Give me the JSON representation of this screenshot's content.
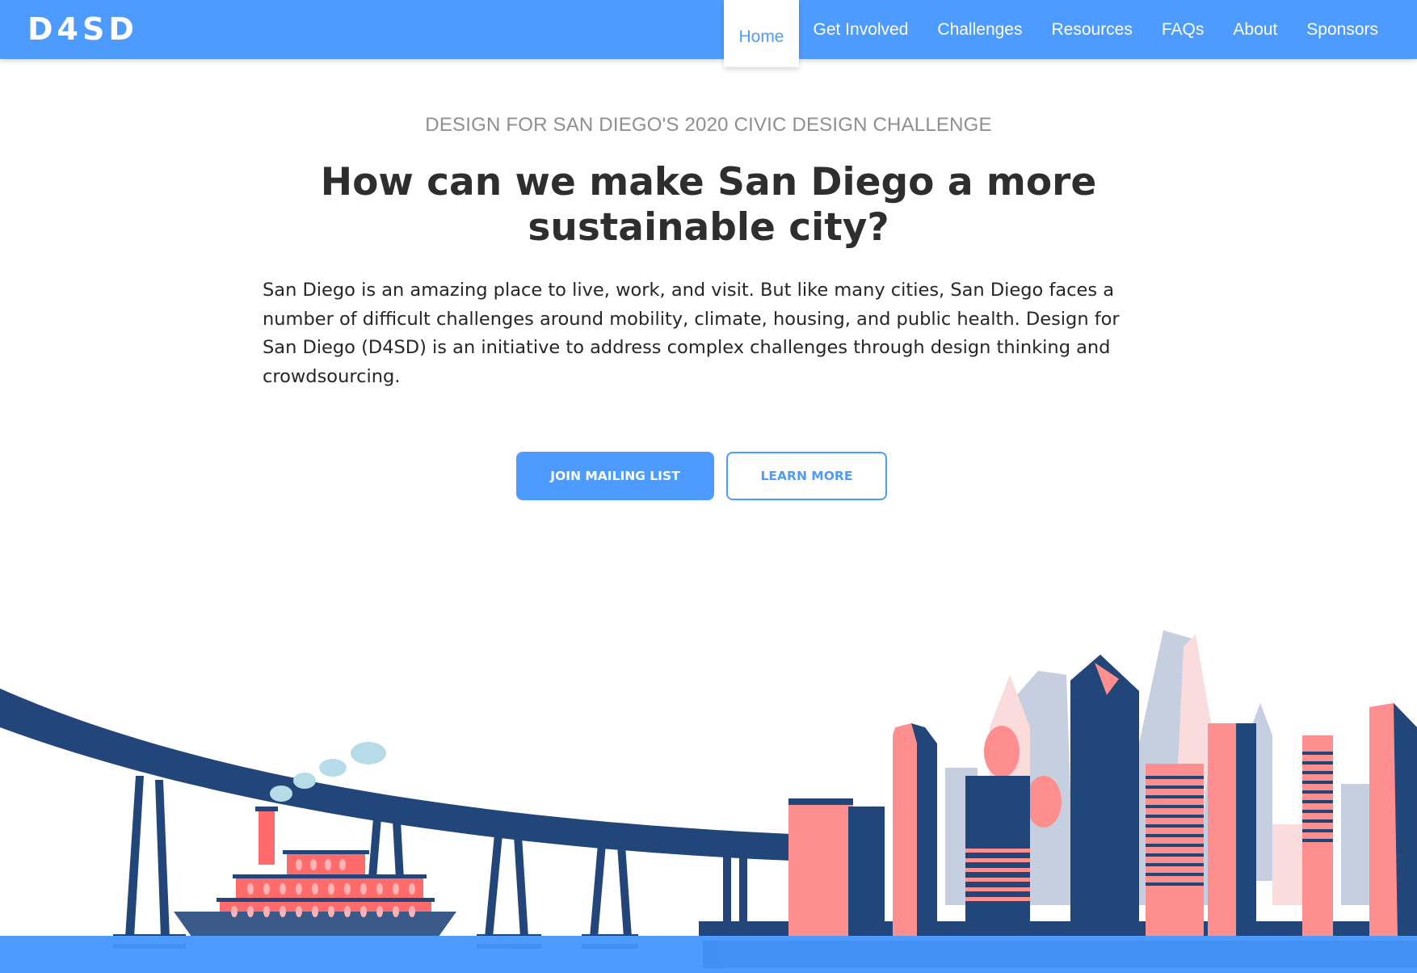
{
  "nav": {
    "logo": "D4SD",
    "items": [
      {
        "label": "Home",
        "active": true
      },
      {
        "label": "Get Involved",
        "active": false
      },
      {
        "label": "Challenges",
        "active": false
      },
      {
        "label": "Resources",
        "active": false
      },
      {
        "label": "FAQs",
        "active": false
      },
      {
        "label": "About",
        "active": false
      },
      {
        "label": "Sponsors",
        "active": false
      }
    ]
  },
  "hero": {
    "eyebrow": "DESIGN FOR SAN DIEGO'S 2020 CIVIC DESIGN CHALLENGE",
    "headline": "How can we make San Diego a more sustainable city?",
    "intro": "San Diego is an amazing place to live, work, and visit. But like many cities, San Diego faces a number of difficult challenges around mobility, climate, housing, and public health. Design for San Diego (D4SD) is an initiative to address complex challenges through design thinking and crowdsourcing."
  },
  "buttons": {
    "primary": "JOIN MAILING LIST",
    "secondary": "LEARN MORE"
  },
  "illustration": {
    "elements": [
      "coronado-bridge",
      "steamboat",
      "steam-clouds",
      "city-skyline",
      "water"
    ]
  },
  "colors": {
    "brand": "#4d9bff",
    "navy": "#22467a",
    "coral": "#ff8e8e",
    "lavender": "#c5cfe0",
    "pink": "#fbdcdc",
    "water": "#4d9bff",
    "steam": "#b5dce8"
  }
}
